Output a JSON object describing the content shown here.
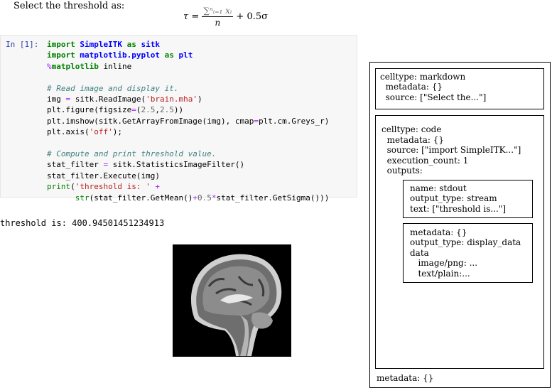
{
  "markdown": {
    "intro_text": "Select the threshold as:",
    "formula": {
      "lhs": "τ =",
      "numerator": "∑ⁿᵢ₌₁ xᵢ",
      "denominator": "n",
      "rhs": "+ 0.5σ"
    }
  },
  "code_cell": {
    "prompt": "In [1]:",
    "lines": [
      "import SimpleITK as sitk",
      "import matplotlib.pyplot as plt",
      "%matplotlib inline",
      "",
      "# Read image and display it.",
      "img = sitk.ReadImage('brain.mha')",
      "plt.figure(figsize=(2.5,2.5))",
      "plt.imshow(sitk.GetArrayFromImage(img), cmap=plt.cm.Greys_r)",
      "plt.axis('off');",
      "",
      "# Compute and print threshold value.",
      "stat_filter = sitk.StatisticsImageFilter()",
      "stat_filter.Execute(img)",
      "print('threshold is: ' +",
      "      str(stat_filter.GetMean()+0.5*stat_filter.GetSigma()))"
    ],
    "output": "threshold is: 400.94501451234913"
  },
  "structure": {
    "markdown_cell": [
      "celltype: markdown",
      "  metadata: {}",
      "  source: [\"Select the...\"]"
    ],
    "code_cell": [
      "celltype: code",
      "  metadata: {}",
      "  source: [\"import SimpleITK...\"]",
      "  execution_count: 1",
      "  outputs:"
    ],
    "stream_output": [
      "name: stdout",
      "output_type: stream",
      "text: [\"threshold is...\"]"
    ],
    "display_output": [
      "metadata: {}",
      "output_type: display_data",
      "data",
      "   image/png: ...",
      "   text/plain:..."
    ],
    "notebook_metadata": "metadata: {}"
  }
}
